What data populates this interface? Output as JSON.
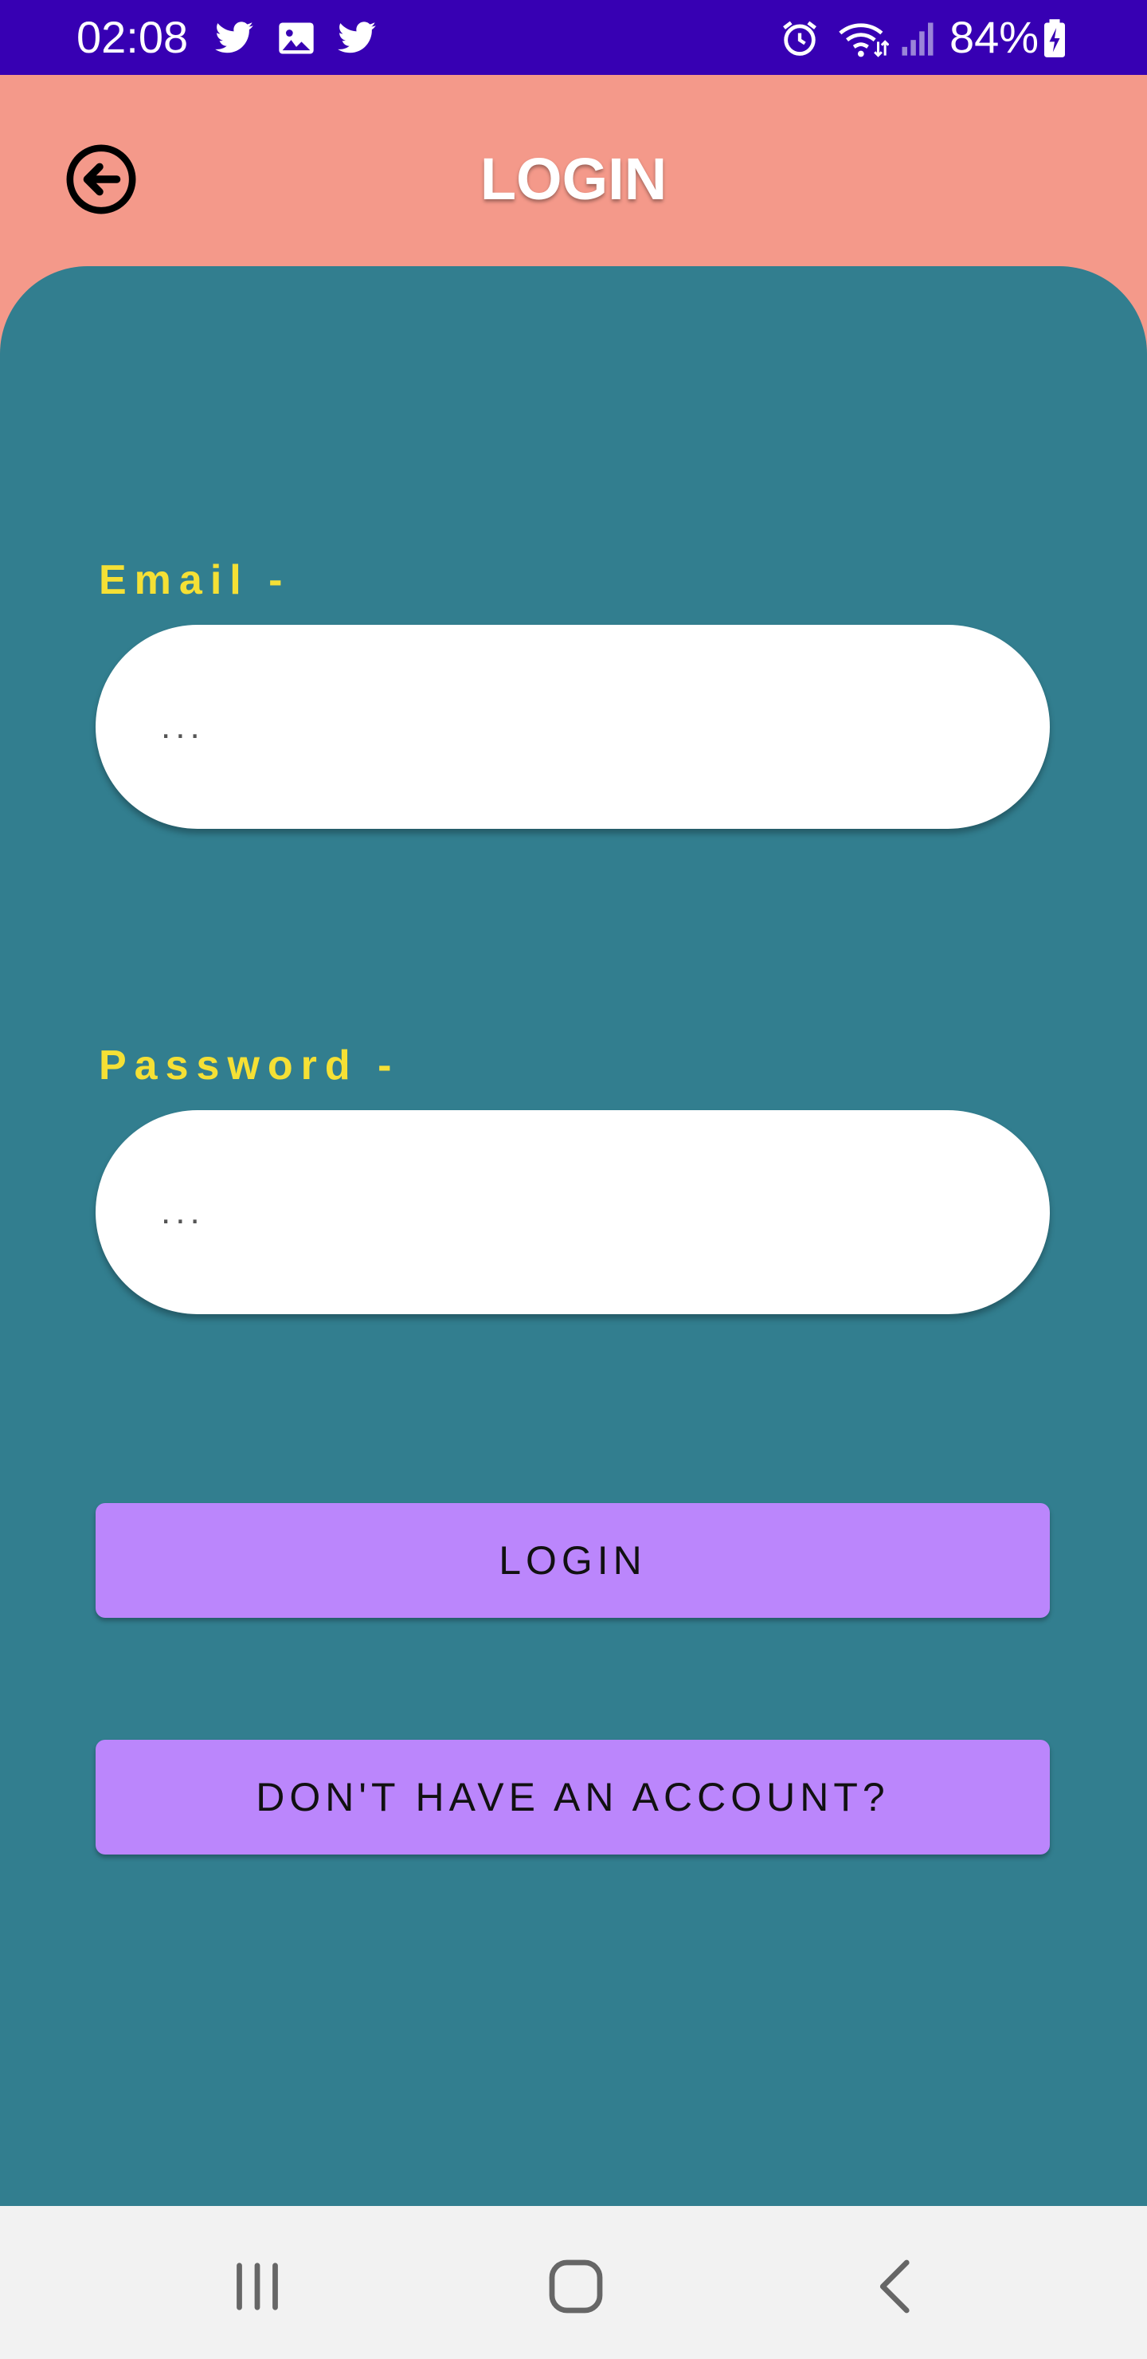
{
  "status_bar": {
    "time": "02:08",
    "battery": "84%",
    "background": "#3700B3",
    "left_icons": [
      "twitter-icon",
      "image-icon",
      "twitter-icon"
    ],
    "right_icons": [
      "alarm-icon",
      "wifi-icon",
      "signal-icon",
      "battery-charging-icon"
    ]
  },
  "app_bar": {
    "title": "LOGIN",
    "back_icon": "arrow-back-circle-icon",
    "background": "#F4998A"
  },
  "form": {
    "background": "#327E8F",
    "label_color": "#F5E035",
    "email_label": "Email -",
    "email_value": "...",
    "password_label": "Password -",
    "password_value": "..."
  },
  "buttons": {
    "login_label": "LOGIN",
    "signup_label": "DON'T HAVE AN ACCOUNT?",
    "color": "#BB86FC"
  },
  "nav_bar": {
    "recents_icon": "recents-icon",
    "home_icon": "home-icon",
    "back_icon": "back-chevron-icon"
  }
}
